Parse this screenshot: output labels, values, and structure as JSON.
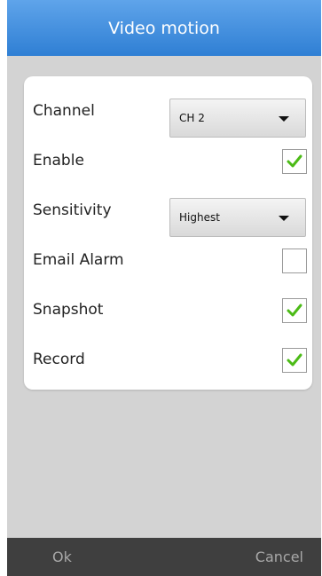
{
  "dialog": {
    "title": "Video motion"
  },
  "fields": {
    "channel": {
      "label": "Channel",
      "value": "CH 2"
    },
    "enable": {
      "label": "Enable",
      "checked": true
    },
    "sensitivity": {
      "label": "Sensitivity",
      "value": "Highest"
    },
    "email_alarm": {
      "label": "Email Alarm",
      "checked": false
    },
    "snapshot": {
      "label": "Snapshot",
      "checked": true
    },
    "record": {
      "label": "Record",
      "checked": true
    }
  },
  "buttons": {
    "ok": "Ok",
    "cancel": "Cancel"
  },
  "colors": {
    "title_bar": "#3b8de0",
    "check_mark": "#4cbb17",
    "background": "#d3d3d3",
    "footer": "#3f3f3f"
  },
  "icons": {
    "dropdown": "caret-down-icon",
    "checked": "checkmark-icon"
  }
}
